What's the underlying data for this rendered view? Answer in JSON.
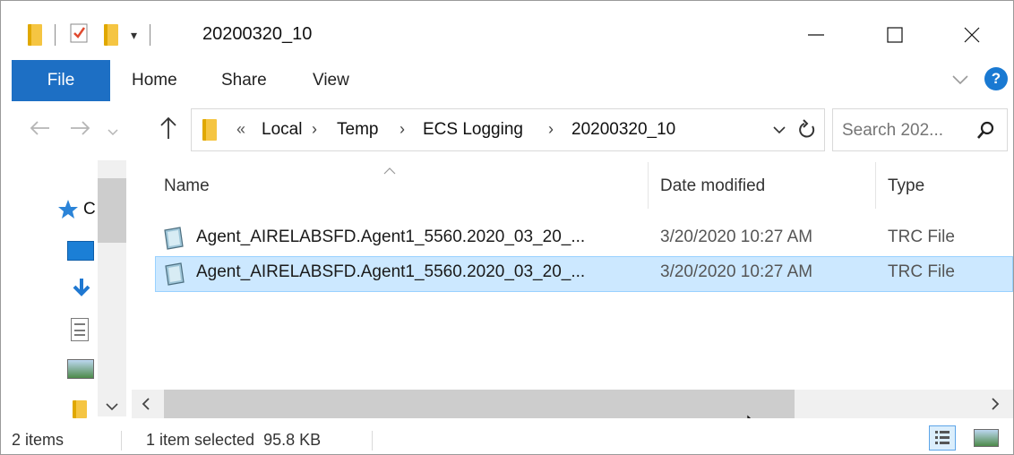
{
  "title": "20200320_10",
  "window_controls": {
    "minimize": "—",
    "maximize": "☐",
    "close": "✕"
  },
  "ribbon": {
    "file": "File",
    "tabs": [
      "Home",
      "Share",
      "View"
    ],
    "help": "?"
  },
  "address": {
    "overflow": "«",
    "crumbs": [
      "Local",
      "Temp",
      "ECS Logging",
      "20200320_10"
    ],
    "separator": "›"
  },
  "search": {
    "placeholder": "Search 202..."
  },
  "columns": {
    "name": "Name",
    "date": "Date modified",
    "type": "Type"
  },
  "nav": {
    "quick_access_label": "C"
  },
  "files": [
    {
      "name": "Agent_AIRELABSFD.Agent1_5560.2020_03_20_...",
      "date": "3/20/2020 10:27 AM",
      "type": "TRC File",
      "selected": false
    },
    {
      "name": "Agent_AIRELABSFD.Agent1_5560.2020_03_20_...",
      "date": "3/20/2020 10:27 AM",
      "type": "TRC File",
      "selected": true
    }
  ],
  "status": {
    "items": "2 items",
    "selection": "1 item selected  95.8 KB"
  },
  "colors": {
    "accent": "#1d6fc4",
    "selection": "#cce8ff",
    "selection_border": "#99d1ff",
    "folder": "#f5c542"
  }
}
